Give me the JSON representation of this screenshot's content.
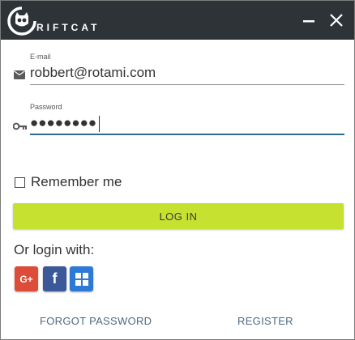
{
  "titlebar": {
    "brand": "RIFTCAT",
    "logo_icon": "riftcat-logo-icon",
    "minimize_icon": "minimize-icon",
    "close_icon": "close-icon"
  },
  "form": {
    "email": {
      "label": "E-mail",
      "value": "robbert@rotami.com",
      "icon": "envelope-icon"
    },
    "password": {
      "label": "Password",
      "masked_value": "●●●●●●●●",
      "icon": "key-icon"
    },
    "remember": {
      "label": "Remember me",
      "checked": false
    },
    "login_button": "LOG IN"
  },
  "social": {
    "heading": "Or login with:",
    "google": "G+",
    "facebook": "f",
    "windows_icon": "windows-icon"
  },
  "links": {
    "forgot": "FORGOT PASSWORD",
    "register": "REGISTER"
  },
  "colors": {
    "titlebar": "#2e3338",
    "login_button": "#c6e12f",
    "google": "#dd4b39",
    "facebook": "#3b5998",
    "windows": "#2d7ad6",
    "link": "#4f6a82"
  }
}
